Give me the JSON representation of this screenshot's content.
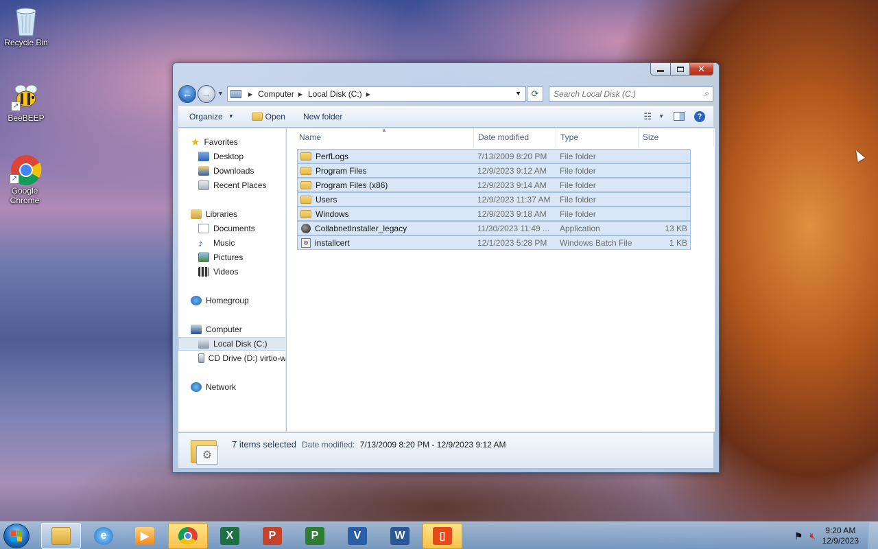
{
  "desktop": {
    "icons": [
      {
        "label": "Recycle Bin"
      },
      {
        "label": "BeeBEEP"
      },
      {
        "label": "Google Chrome"
      }
    ]
  },
  "window": {
    "address": {
      "crumbs": [
        "Computer",
        "Local Disk (C:)"
      ]
    },
    "search": {
      "placeholder": "Search Local Disk (C:)"
    },
    "toolbar": {
      "organize_label": "Organize",
      "open_label": "Open",
      "new_folder_label": "New folder"
    },
    "nav_pane": {
      "favorites": "Favorites",
      "desktop": "Desktop",
      "downloads": "Downloads",
      "recent_places": "Recent Places",
      "libraries": "Libraries",
      "documents": "Documents",
      "music": "Music",
      "pictures": "Pictures",
      "videos": "Videos",
      "homegroup": "Homegroup",
      "computer": "Computer",
      "local_disk": "Local Disk (C:)",
      "cd_drive": "CD Drive (D:) virtio-w",
      "network": "Network"
    },
    "columns": {
      "name": "Name",
      "date_modified": "Date modified",
      "type": "Type",
      "size": "Size"
    },
    "files": [
      {
        "name": "PerfLogs",
        "date": "7/13/2009 8:20 PM",
        "type": "File folder",
        "size": "",
        "icon": "folder-icon"
      },
      {
        "name": "Program Files",
        "date": "12/9/2023 9:12 AM",
        "type": "File folder",
        "size": "",
        "icon": "folder-icon"
      },
      {
        "name": "Program Files (x86)",
        "date": "12/9/2023 9:14 AM",
        "type": "File folder",
        "size": "",
        "icon": "folder-icon"
      },
      {
        "name": "Users",
        "date": "12/9/2023 11:37 AM",
        "type": "File folder",
        "size": "",
        "icon": "folder-icon"
      },
      {
        "name": "Windows",
        "date": "12/9/2023 9:18 AM",
        "type": "File folder",
        "size": "",
        "icon": "folder-icon"
      },
      {
        "name": "CollabnetInstaller_legacy",
        "date": "11/30/2023 11:49 ...",
        "type": "Application",
        "size": "13 KB",
        "icon": "application-icon"
      },
      {
        "name": "installcert",
        "date": "12/1/2023 5:28 PM",
        "type": "Windows Batch File",
        "size": "1 KB",
        "icon": "batch-file-icon"
      }
    ],
    "details": {
      "count": "7 items selected",
      "date_label": "Date modified:",
      "date_value": "7/13/2009 8:20 PM - 12/9/2023 9:12 AM"
    }
  },
  "taskbar": {
    "apps": [
      "explorer",
      "internet-explorer",
      "media-player",
      "chrome",
      "excel",
      "powerpoint",
      "project",
      "visio",
      "word",
      "office"
    ],
    "clock": {
      "time": "9:20 AM",
      "date": "12/9/2023"
    }
  },
  "colors": {
    "selection": "#d8e6f5",
    "taskbar_active": "#f7c24a"
  }
}
